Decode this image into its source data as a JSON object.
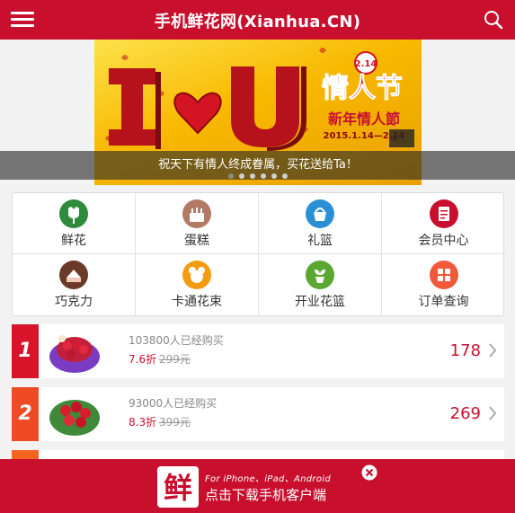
{
  "header": {
    "title": "手机鲜花网(Xianhua.CN)"
  },
  "icons": {
    "menu": "menu-icon",
    "search": "search-icon"
  },
  "banner": {
    "caption": "祝天下有情人终成眷属，买花送给Ta！",
    "headline": "新年情人節",
    "dates": "2015.1.14—2.14",
    "badge_date": "2.14",
    "badge_text": "情人节",
    "slide_count": 6,
    "active_slide": 1
  },
  "categories": [
    {
      "label": "鲜花",
      "icon": "flower-icon",
      "color": "#2e8b3c"
    },
    {
      "label": "蛋糕",
      "icon": "cake-icon",
      "color": "#b07a64"
    },
    {
      "label": "礼篮",
      "icon": "basket-icon",
      "color": "#2b8fd6"
    },
    {
      "label": "会员中心",
      "icon": "member-icon",
      "color": "#c8102e"
    },
    {
      "label": "巧克力",
      "icon": "chocolate-icon",
      "color": "#6b3a2a"
    },
    {
      "label": "卡通花束",
      "icon": "cartoon-icon",
      "color": "#f39c12"
    },
    {
      "label": "开业花篮",
      "icon": "plant-icon",
      "color": "#5aa832"
    },
    {
      "label": "订单查询",
      "icon": "order-grid-icon",
      "color": "#f05a3a"
    }
  ],
  "ranking": [
    {
      "rank": "1",
      "sold": "103800人已经购买",
      "discount": "7.6折",
      "original": "299元",
      "price": "178",
      "color": "#d7142a"
    },
    {
      "rank": "2",
      "sold": "93000人已经购买",
      "discount": "8.3折",
      "original": "399元",
      "price": "269",
      "color": "#ee4a24"
    }
  ],
  "download": {
    "logo_char": "鲜",
    "subtitle": "For iPhone、iPad、Android",
    "label": "点击下载手机客户端"
  }
}
